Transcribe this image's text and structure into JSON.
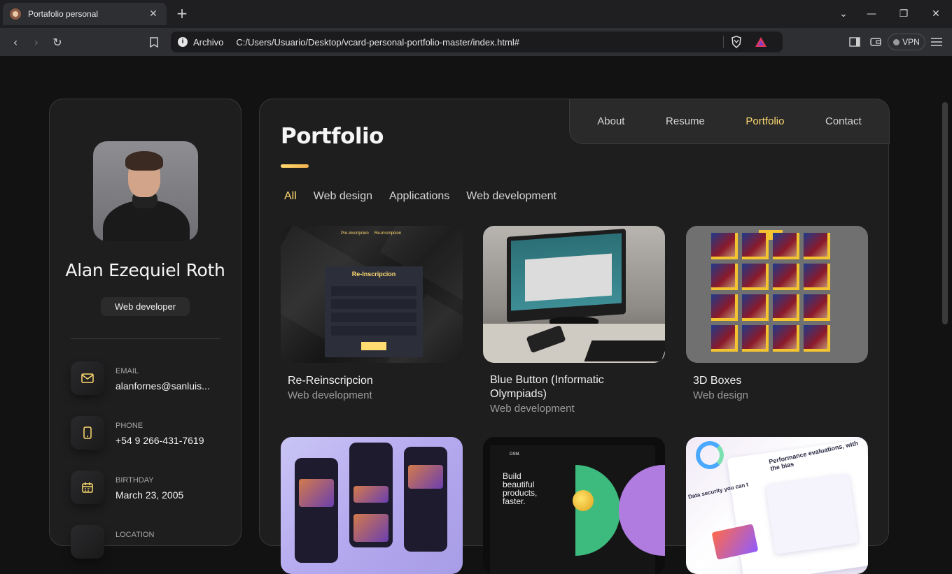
{
  "browser": {
    "tab_title": "Portafolio personal",
    "new_tab": "+",
    "scheme_label": "Archivo",
    "url": "C:/Users/Usuario/Desktop/vcard-personal-portfolio-master/index.html#",
    "vpn_label": "VPN"
  },
  "sidebar": {
    "name": "Alan Ezequiel Roth",
    "role": "Web developer",
    "contacts": [
      {
        "label": "Email",
        "value": "alanfornes@sanluis...",
        "icon": "mail-icon"
      },
      {
        "label": "Phone",
        "value": "+54 9 266-431-7619",
        "icon": "phone-icon"
      },
      {
        "label": "Birthday",
        "value": "March 23, 2005",
        "icon": "calendar-icon"
      },
      {
        "label": "Location",
        "value": "",
        "icon": "location-icon"
      }
    ]
  },
  "nav": {
    "links": [
      "About",
      "Resume",
      "Portfolio",
      "Contact"
    ],
    "active": "Portfolio"
  },
  "portfolio": {
    "title": "Portfolio",
    "filters": [
      "All",
      "Web design",
      "Applications",
      "Web development"
    ],
    "active_filter": "All",
    "projects": [
      {
        "title": "Re-Reinscripcion",
        "category": "Web development"
      },
      {
        "title": "Blue Button (Informatic Olympiads)",
        "category": "Web development"
      },
      {
        "title": "3D Boxes",
        "category": "Web design"
      },
      {
        "title": "",
        "category": ""
      },
      {
        "title": "",
        "category": ""
      },
      {
        "title": "",
        "category": ""
      }
    ],
    "thumb_text": {
      "t1_tab_a": "Pre-inscripcion",
      "t1_tab_b": "Re-inscripcion",
      "t1_form_title": "Re-Inscripcion",
      "t5_logo": "DSM.",
      "t5_heading": "Build beautiful products, faster.",
      "t6_heading": "Performance evaluations, with the bias",
      "t6_sub": "Data security you can t"
    }
  },
  "colors": {
    "accent": "#ffdb70",
    "bg": "#121212",
    "panel": "#1e1e1f"
  }
}
